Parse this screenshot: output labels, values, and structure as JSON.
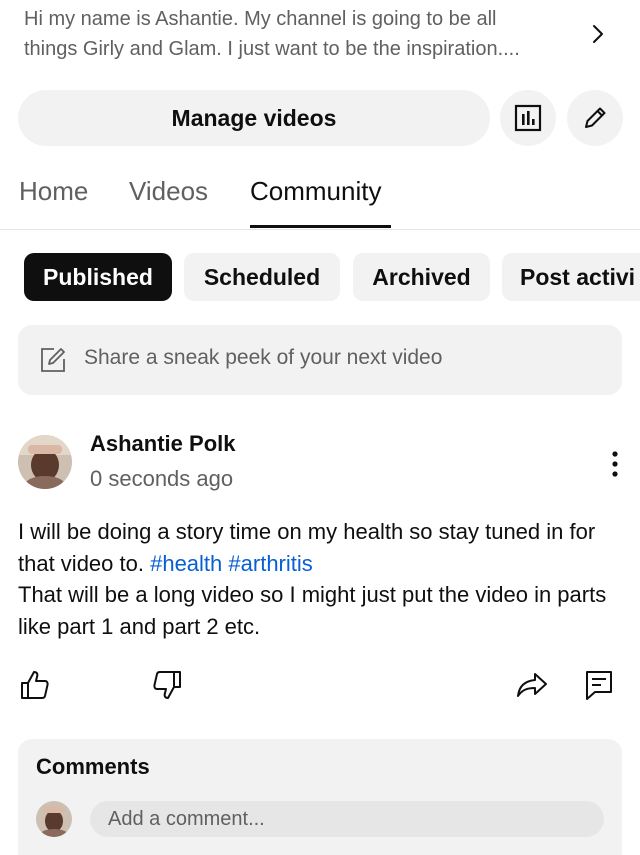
{
  "channel": {
    "description": "Hi my name is Ashantie. My channel is going to be all\nthings Girly and Glam.  I just want to be the inspiration...."
  },
  "actions": {
    "manage_videos": "Manage videos"
  },
  "tabs": [
    {
      "label": "Home",
      "active": false
    },
    {
      "label": "Videos",
      "active": false
    },
    {
      "label": "Community",
      "active": true
    }
  ],
  "filters": [
    {
      "label": "Published",
      "active": true
    },
    {
      "label": "Scheduled",
      "active": false
    },
    {
      "label": "Archived",
      "active": false
    },
    {
      "label": "Post activi",
      "active": false
    }
  ],
  "composer": {
    "placeholder": "Share a sneak peek of your next video"
  },
  "post": {
    "author": "Ashantie Polk",
    "timestamp": "0 seconds ago",
    "text_part1": "I will be doing a story time on my health so stay tuned in for that video to. ",
    "hashtag1": "#health",
    "hashtag2": "#arthritis",
    "text_part2": "That will be a long video so I might just put the video in parts like part 1 and part 2 etc."
  },
  "comments": {
    "title": "Comments",
    "placeholder": "Add a comment..."
  },
  "colors": {
    "link": "#065fd4",
    "chip_active_bg": "#0f0f0f",
    "surface": "#f2f2f2",
    "secondary_text": "#606060"
  },
  "icons": [
    "chevron-right-icon",
    "analytics-icon",
    "edit-pencil-icon",
    "edit-note-icon",
    "more-vert-icon",
    "thumb-up-icon",
    "thumb-down-icon",
    "share-icon",
    "comment-icon"
  ]
}
